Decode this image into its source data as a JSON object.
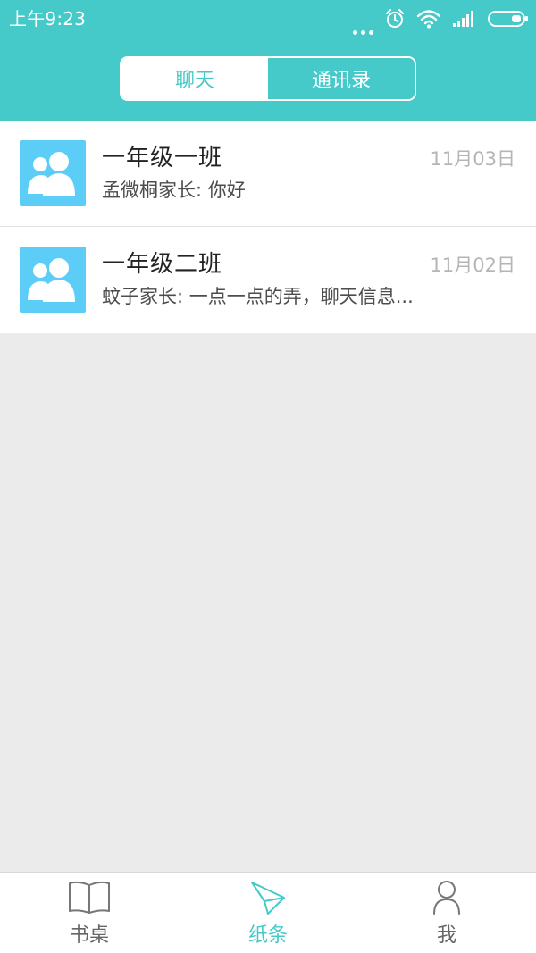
{
  "status_bar": {
    "time": "上午9:23",
    "icons": [
      "more-dots-icon",
      "alarm-icon",
      "wifi-icon",
      "signal-icon",
      "battery-icon"
    ]
  },
  "tabs": [
    {
      "label": "聊天",
      "active": true
    },
    {
      "label": "通讯录",
      "active": false
    }
  ],
  "chats": [
    {
      "name": "一年级一班",
      "date": "11月03日",
      "last_message": "孟微桐家长: 你好",
      "icon": "group-icon"
    },
    {
      "name": "一年级二班",
      "date": "11月02日",
      "last_message": "蚊子家长: 一点一点的弄，聊天信息...",
      "icon": "group-icon"
    }
  ],
  "bottom_nav": [
    {
      "label": "书桌",
      "icon": "book-icon",
      "active": false
    },
    {
      "label": "纸条",
      "icon": "paper-plane-icon",
      "active": true
    },
    {
      "label": "我",
      "icon": "person-icon",
      "active": false
    }
  ],
  "colors": {
    "accent": "#45c9c9",
    "avatar_bg": "#5ccdf6",
    "page_bg": "#ebebeb",
    "date_text": "#b5b5b5"
  }
}
